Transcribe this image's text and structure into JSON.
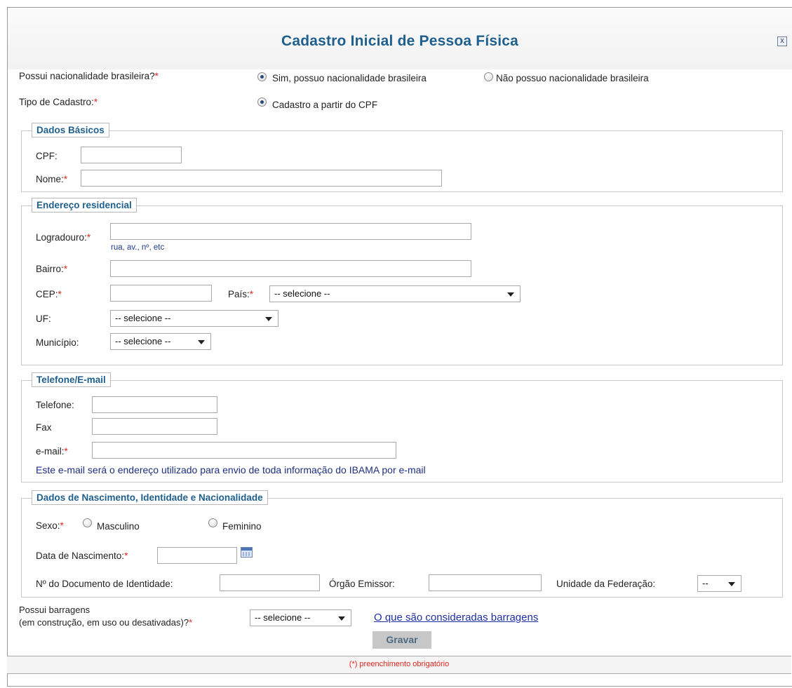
{
  "dialog": {
    "title": "Cadastro Inicial de Pessoa Física",
    "close_glyph": "x"
  },
  "nationality": {
    "label": "Possui nacionalidade brasileira?",
    "options": [
      {
        "label": "Sim, possuo nacionalidade brasileira",
        "checked": true
      },
      {
        "label": "Não possuo nacionalidade brasileira",
        "checked": false
      }
    ]
  },
  "tipo_cadastro": {
    "label": "Tipo de Cadastro:",
    "option": "Cadastro a partir do CPF"
  },
  "required_mark": "*",
  "dados_basicos": {
    "legend": "Dados Básicos",
    "cpf_label": "CPF:",
    "cpf_value": "",
    "nome_label": "Nome:",
    "nome_value": ""
  },
  "endereco": {
    "legend": "Endereço residencial",
    "logradouro_label": "Logradouro:",
    "logradouro_hint": "rua, av., nº, etc",
    "bairro_label": "Bairro:",
    "cep_label": "CEP:",
    "pais_label": "País:",
    "pais_selected": "-- selecione --",
    "uf_label": "UF:",
    "uf_selected": "-- selecione --",
    "municipio_label": "Município:",
    "municipio_selected": "-- selecione --"
  },
  "contato": {
    "legend": "Telefone/E-mail",
    "telefone_label": "Telefone:",
    "fax_label": "Fax",
    "email_label": "e-mail:",
    "notice": "Este e-mail será o endereço utilizado para envio de toda informação do IBAMA por e-mail"
  },
  "nascimento": {
    "legend": "Dados de Nascimento, Identidade e Nacionalidade",
    "sexo_label": "Sexo:",
    "sexo_options": [
      "Masculino",
      "Feminino"
    ],
    "data_label": "Data de Nascimento:",
    "doc_label": "Nº do Documento de Identidade:",
    "orgao_label": "Órgão Emissor:",
    "uf_label": "Unidade da Federação:",
    "uf_selected": "--"
  },
  "barragens": {
    "label_line1": "Possui barragens",
    "label_line2": "(em construção, em uso ou desativadas)?",
    "selected": "-- selecione --",
    "link": "O que são consideradas barragens"
  },
  "actions": {
    "save_label": "Gravar"
  },
  "footer": {
    "note": "(*) preenchimento obrigatório"
  },
  "colors": {
    "title": "#1f5f8d",
    "required": "#e0261f",
    "legend": "#1f5f8d",
    "link": "#1f2fa5"
  }
}
